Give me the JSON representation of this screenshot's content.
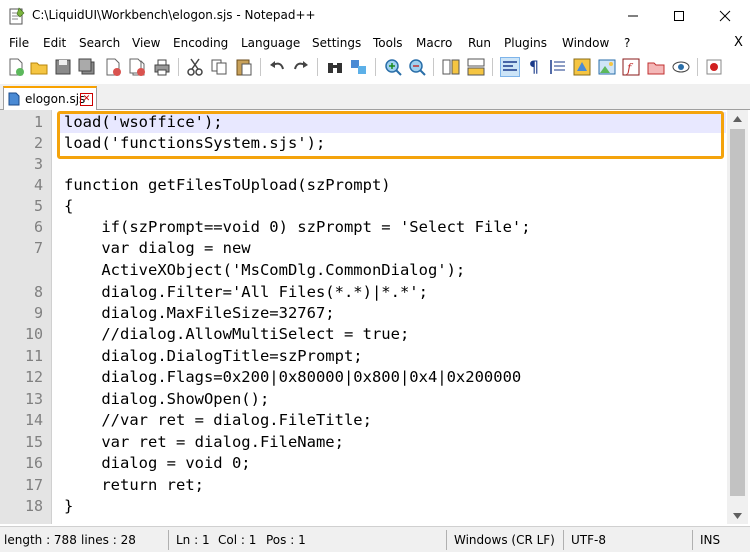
{
  "window": {
    "title": "C:\\LiquidUI\\Workbench\\elogon.sjs - Notepad++"
  },
  "menu": {
    "items": [
      "File",
      "Edit",
      "Search",
      "View",
      "Encoding",
      "Language",
      "Settings",
      "Tools",
      "Macro",
      "Run",
      "Plugins",
      "Window",
      "?"
    ],
    "close_glyph": "X"
  },
  "tabs": [
    {
      "label": "elogon.sjs"
    }
  ],
  "editor": {
    "lines": [
      {
        "num": "1",
        "text": "load('wsoffice');"
      },
      {
        "num": "2",
        "text": "load('functionsSystem.sjs');"
      },
      {
        "num": "3",
        "text": ""
      },
      {
        "num": "4",
        "text": "function getFilesToUpload(szPrompt)"
      },
      {
        "num": "5",
        "text": "{"
      },
      {
        "num": "6",
        "text": "    if(szPrompt==void 0) szPrompt = 'Select File';"
      },
      {
        "num": "7",
        "text": "    var dialog = new"
      },
      {
        "num": "",
        "text": "    ActiveXObject('MsComDlg.CommonDialog');"
      },
      {
        "num": "8",
        "text": "    dialog.Filter='All Files(*.*)|*.*';"
      },
      {
        "num": "9",
        "text": "    dialog.MaxFileSize=32767;"
      },
      {
        "num": "10",
        "text": "    //dialog.AllowMultiSelect = true;"
      },
      {
        "num": "11",
        "text": "    dialog.DialogTitle=szPrompt;"
      },
      {
        "num": "12",
        "text": "    dialog.Flags=0x200|0x80000|0x800|0x4|0x200000"
      },
      {
        "num": "13",
        "text": "    dialog.ShowOpen();"
      },
      {
        "num": "14",
        "text": "    //var ret = dialog.FileTitle;"
      },
      {
        "num": "15",
        "text": "    var ret = dialog.FileName;"
      },
      {
        "num": "16",
        "text": "    dialog = void 0;"
      },
      {
        "num": "17",
        "text": "    return ret;"
      },
      {
        "num": "18",
        "text": "}"
      }
    ]
  },
  "status": {
    "length": "length : 788",
    "lines": "lines : 28",
    "ln": "Ln : 1",
    "col": "Col : 1",
    "pos": "Pos : 1",
    "eol": "Windows (CR LF)",
    "encoding": "UTF-8",
    "mode": "INS"
  },
  "colors": {
    "highlight": "#f4a30c",
    "caret_line": "#e8e8ff",
    "gutter": "#e4e4e4"
  }
}
